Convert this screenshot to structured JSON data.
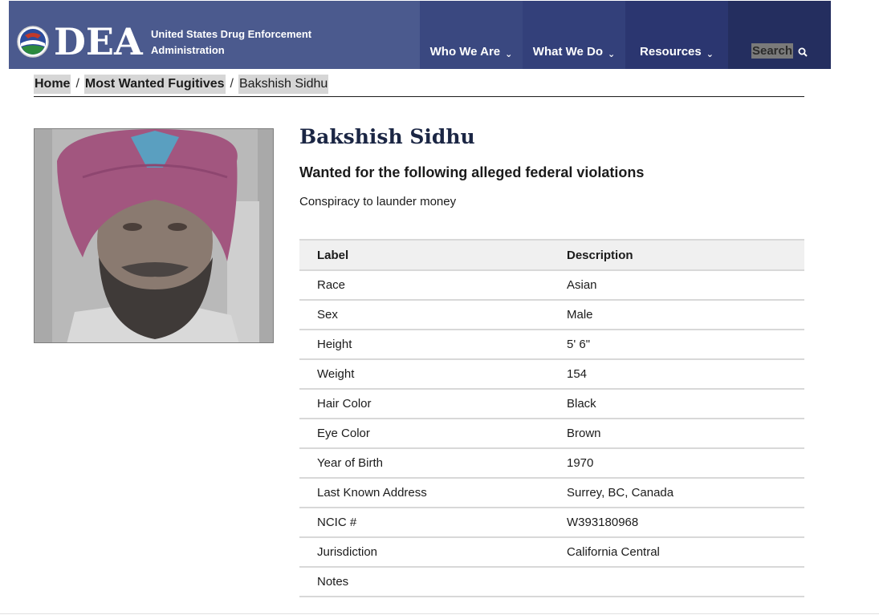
{
  "header": {
    "wordmark": "DEA",
    "agency_line1": "United States Drug Enforcement",
    "agency_line2": "Administration",
    "nav": [
      {
        "label": "Who We Are"
      },
      {
        "label": "What We Do"
      },
      {
        "label": "Resources"
      }
    ],
    "search_label": "Search",
    "colors": {
      "header_bg": "#4b5a8e",
      "accent": "#c8a23c"
    }
  },
  "breadcrumb": {
    "items": [
      "Home",
      "Most Wanted Fugitives",
      "Bakshish Sidhu"
    ],
    "separator": "/"
  },
  "fugitive": {
    "name": "Bakshish Sidhu",
    "subhead": "Wanted for the following alleged federal violations",
    "violation": "Conspiracy to launder money",
    "table": {
      "headers": [
        "Label",
        "Description"
      ],
      "rows": [
        [
          "Race",
          "Asian"
        ],
        [
          "Sex",
          "Male"
        ],
        [
          "Height",
          "5' 6\""
        ],
        [
          "Weight",
          "154"
        ],
        [
          "Hair Color",
          "Black"
        ],
        [
          "Eye Color",
          "Brown"
        ],
        [
          "Year of Birth",
          "1970"
        ],
        [
          "Last Known Address",
          "Surrey, BC, Canada"
        ],
        [
          "NCIC #",
          "W393180968"
        ],
        [
          "Jurisdiction",
          "California Central"
        ],
        [
          "Notes",
          ""
        ]
      ]
    }
  }
}
